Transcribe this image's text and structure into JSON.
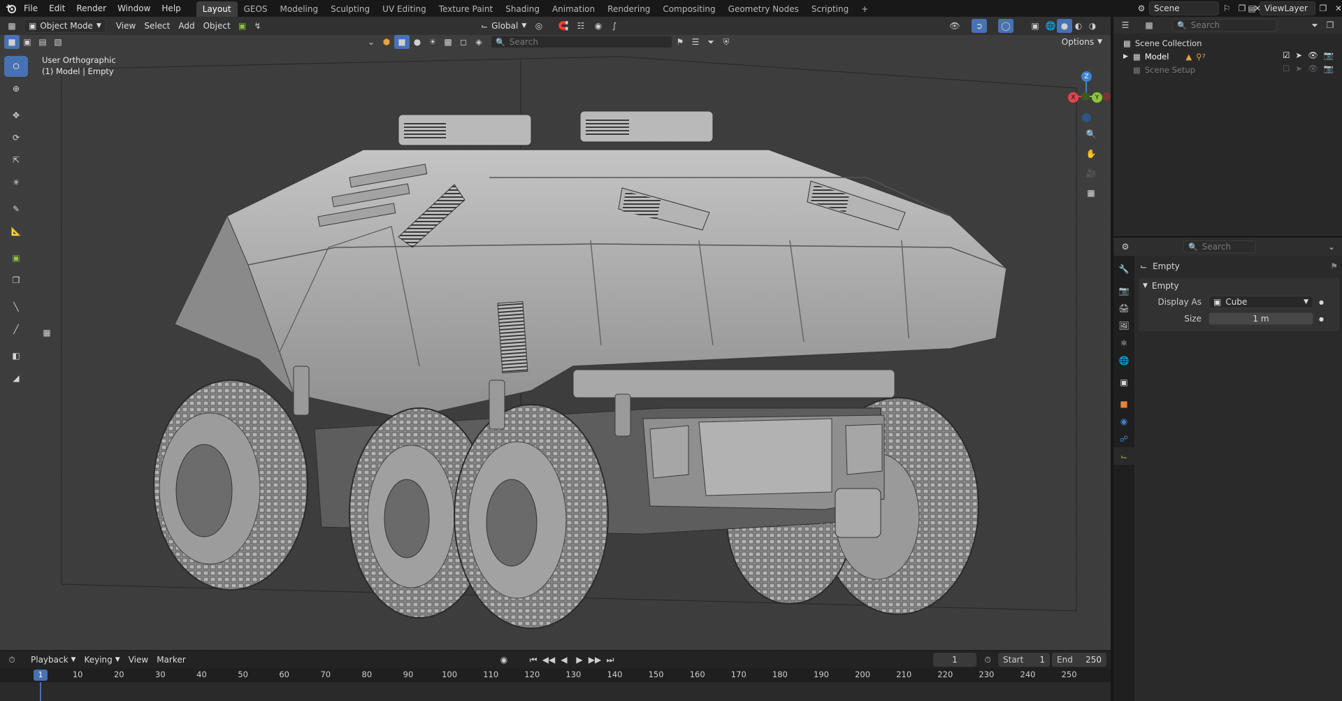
{
  "menu": {
    "items": [
      "File",
      "Edit",
      "Render",
      "Window",
      "Help"
    ]
  },
  "workspaces": {
    "tabs": [
      "Layout",
      "GEOS",
      "Modeling",
      "Sculpting",
      "UV Editing",
      "Texture Paint",
      "Shading",
      "Animation",
      "Rendering",
      "Compositing",
      "Geometry Nodes",
      "Scripting"
    ],
    "active": "Layout",
    "add": "+"
  },
  "scene": {
    "scene_name": "Scene",
    "view_layer": "ViewLayer"
  },
  "viewport": {
    "mode": "Object Mode",
    "menus": [
      "View",
      "Select",
      "Add",
      "Object"
    ],
    "orientation": "Global",
    "search_placeholder": "Search",
    "options": "Options",
    "view_name": "User Orthographic",
    "context": "(1) Model | Empty",
    "gizmo": {
      "z": "Z",
      "y": "Y",
      "x": "X"
    }
  },
  "outliner": {
    "search_placeholder": "Search",
    "root": "Scene Collection",
    "rows": [
      {
        "label": "Model",
        "enabled": true,
        "badge": "7"
      },
      {
        "label": "Scene Setup",
        "enabled": false
      }
    ]
  },
  "properties": {
    "search_placeholder": "Search",
    "object_name": "Empty",
    "panel_title": "Empty",
    "display_as_label": "Display As",
    "display_as_value": "Cube",
    "size_label": "Size",
    "size_value": "1 m"
  },
  "timeline": {
    "menus": [
      "Playback",
      "Keying",
      "View",
      "Marker"
    ],
    "current_frame": "1",
    "start_label": "Start",
    "start_value": "1",
    "end_label": "End",
    "end_value": "250",
    "playhead": "1",
    "ticks": [
      "10",
      "20",
      "30",
      "40",
      "50",
      "60",
      "70",
      "80",
      "90",
      "100",
      "110",
      "120",
      "130",
      "140",
      "150",
      "160",
      "170",
      "180",
      "190",
      "200",
      "210",
      "220",
      "230",
      "240",
      "250"
    ]
  },
  "colors": {
    "accent": "#4772b3",
    "viewport_bg": "#3c3c3c",
    "axis_x": "#e0454d",
    "axis_y": "#8cc43d",
    "axis_z": "#3f84d1"
  }
}
